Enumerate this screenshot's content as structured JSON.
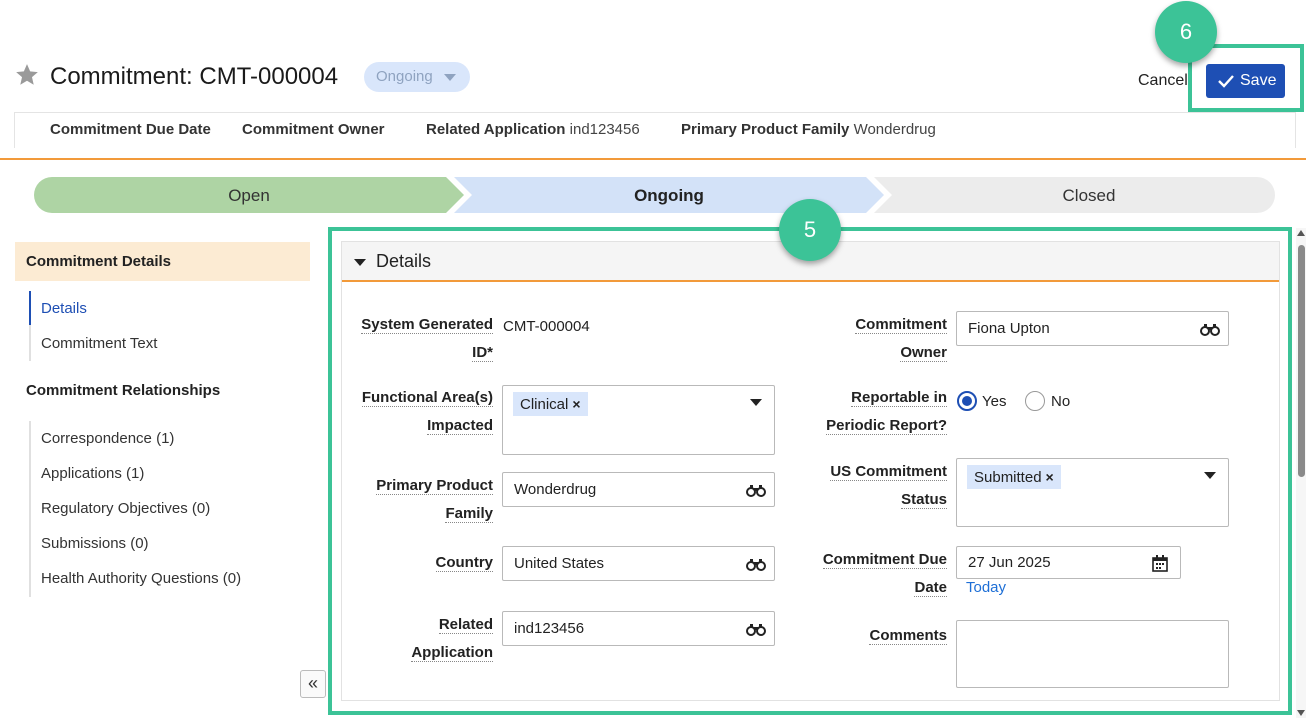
{
  "header": {
    "title": "Commitment: CMT-000004",
    "status": "Ongoing",
    "cancel_label": "Cancel",
    "save_label": "Save"
  },
  "callouts": {
    "badge_save": "6",
    "badge_form": "5"
  },
  "summary": {
    "due_date_label": "Commitment Due Date",
    "owner_label": "Commitment Owner",
    "related_app_label": "Related Application",
    "related_app_value": "ind123456",
    "product_family_label": "Primary Product Family",
    "product_family_value": "Wonderdrug"
  },
  "stages": [
    {
      "label": "Open",
      "state": "complete"
    },
    {
      "label": "Ongoing",
      "state": "current"
    },
    {
      "label": "Closed",
      "state": "pending"
    }
  ],
  "nav": {
    "section1": "Commitment Details",
    "section1_items": [
      "Details",
      "Commitment Text"
    ],
    "section2": "Commitment Relationships",
    "section2_items": [
      "Correspondence (1)",
      "Applications (1)",
      "Regulatory Objectives (0)",
      "Submissions (0)",
      "Health Authority Questions (0)"
    ],
    "collapse_glyph": "«"
  },
  "panel": {
    "title": "Details",
    "fields": {
      "system_id_label_1": "System Generated",
      "system_id_label_2": "ID*",
      "system_id_value": "CMT-000004",
      "functional_label_1": "Functional Area(s)",
      "functional_label_2": "Impacted",
      "functional_chip": "Clinical",
      "product_label_1": "Primary Product",
      "product_label_2": "Family",
      "product_value": "Wonderdrug",
      "country_label": "Country",
      "country_value": "United States",
      "related_label_1": "Related",
      "related_label_2": "Application",
      "related_value": "ind123456",
      "owner_label_1": "Commitment",
      "owner_label_2": "Owner",
      "owner_value": "Fiona Upton",
      "reportable_label_1": "Reportable in",
      "reportable_label_2": "Periodic Report?",
      "reportable_yes": "Yes",
      "reportable_no": "No",
      "us_status_label_1": "US Commitment",
      "us_status_label_2": "Status",
      "us_status_chip": "Submitted",
      "due_label_1": "Commitment Due",
      "due_label_2": "Date",
      "due_value": "27 Jun 2025",
      "today_link": "Today",
      "comments_label": "Comments",
      "chip_remove": "×"
    }
  },
  "colors": {
    "accent_green": "#3cc397",
    "primary_blue": "#1e4fb4",
    "orange_rule": "#f29a3a",
    "stage_complete": "#aed4a4",
    "stage_current": "#d3e2f8",
    "stage_pending": "#ececec"
  }
}
